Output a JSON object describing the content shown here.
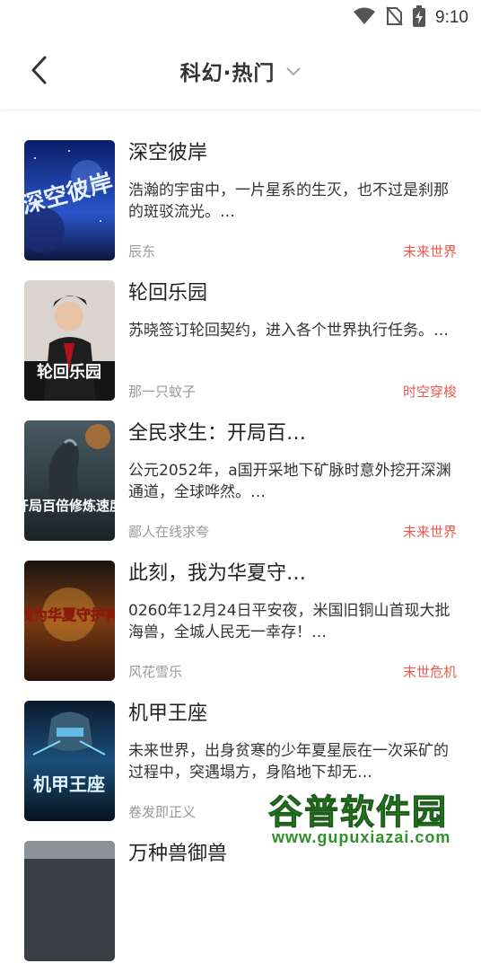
{
  "status_bar": {
    "time": "9:10",
    "icons": [
      "wifi-icon",
      "no-sim-icon",
      "battery-charging-icon"
    ]
  },
  "header": {
    "title": "科幻·热门",
    "back_icon": "back-arrow-icon",
    "dropdown_icon": "chevron-down-icon"
  },
  "colors": {
    "tag": "#e85a4f",
    "author": "#999999",
    "text": "#222222"
  },
  "books": [
    {
      "title": "深空彼岸",
      "desc": "浩瀚的宇宙中，一片星系的生灭，也不过是刹那的斑驳流光。…",
      "author": "辰东",
      "tag": "未来世界",
      "cover_text": "深空彼岸"
    },
    {
      "title": "轮回乐园",
      "desc": "苏晓签订轮回契约，进入各个世界执行任务。…",
      "author": "那一只蚊子",
      "tag": "时空穿梭",
      "cover_text": "轮回乐园"
    },
    {
      "title": "全民求生：开局百…",
      "desc": "公元2052年，a国开采地下矿脉时意外挖开深渊通道，全球哗然。…",
      "author": "鄙人在线求夸",
      "tag": "未来世界",
      "cover_text": "开局百倍修炼速度"
    },
    {
      "title": "此刻，我为华夏守…",
      "desc": "0260年12月24日平安夜，米国旧铜山首现大批海兽，全城人民无一幸存！…",
      "author": "风花雪乐",
      "tag": "末世危机",
      "cover_text": "我为华夏守护神"
    },
    {
      "title": "机甲王座",
      "desc": "未来世界，出身贫寒的少年夏星辰在一次采矿的过程中，突遇塌方，身陷地下却无…",
      "author": "卷发即正义",
      "tag": "",
      "cover_text": "机甲王座"
    },
    {
      "title": "万种兽御兽",
      "desc": "",
      "author": "",
      "tag": "",
      "cover_text": ""
    }
  ],
  "watermark": {
    "text": "谷普软件园",
    "url": "www.gupuxiazai.com"
  }
}
